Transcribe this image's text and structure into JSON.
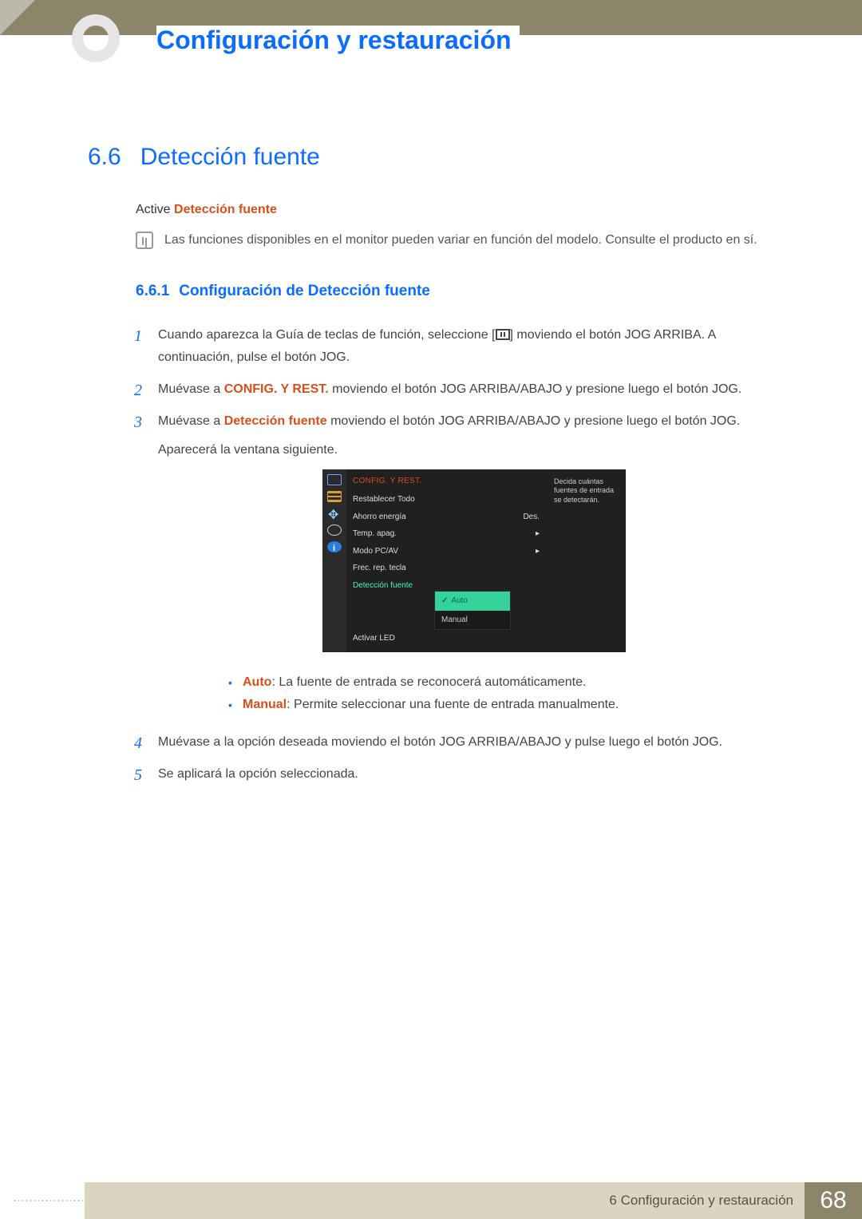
{
  "header": {
    "chapter_title": "Configuración y restauración"
  },
  "section": {
    "number": "6.6",
    "title": "Detección fuente",
    "intro_prefix": "Active ",
    "intro_highlight": "Detección fuente",
    "note": "Las funciones disponibles en el monitor pueden variar en función del modelo. Consulte el producto en sí."
  },
  "subsection": {
    "number": "6.6.1",
    "title": "Configuración de Detección fuente"
  },
  "steps": {
    "s1a": "Cuando aparezca la Guía de teclas de función, seleccione [",
    "s1b": "] moviendo el botón JOG ARRIBA. A continuación, pulse el botón JOG.",
    "s2a": "Muévase a ",
    "s2hl": "CONFIG. Y REST.",
    "s2b": " moviendo el botón JOG ARRIBA/ABAJO y presione luego el botón JOG.",
    "s3a": "Muévase a ",
    "s3hl": "Detección fuente",
    "s3b": " moviendo el botón JOG ARRIBA/ABAJO y presione luego el botón JOG.",
    "s3c": "Aparecerá la ventana siguiente.",
    "s4": "Muévase a la opción deseada moviendo el botón JOG ARRIBA/ABAJO y pulse luego el botón JOG.",
    "s5": "Se aplicará la opción seleccionada."
  },
  "osd": {
    "title": "CONFIG. Y REST.",
    "rows": [
      {
        "label": "Restablecer Todo",
        "value": ""
      },
      {
        "label": "Ahorro energía",
        "value": "Des."
      },
      {
        "label": "Temp. apag.",
        "value": "▸"
      },
      {
        "label": "Modo PC/AV",
        "value": "▸"
      },
      {
        "label": "Frec. rep. tecla",
        "value": ""
      }
    ],
    "selected": "Detección fuente",
    "options": {
      "active": "Auto",
      "other": "Manual"
    },
    "last_row": "Activar LED",
    "hint": "Decida cuántas fuentes de entrada se detectarán."
  },
  "bullets": {
    "b1_label": "Auto",
    "b1_text": ": La fuente de entrada se reconocerá automáticamente.",
    "b2_label": "Manual",
    "b2_text": ": Permite seleccionar una fuente de entrada manualmente."
  },
  "footer": {
    "chapter_ref": "6 Configuración y restauración",
    "page": "68"
  }
}
